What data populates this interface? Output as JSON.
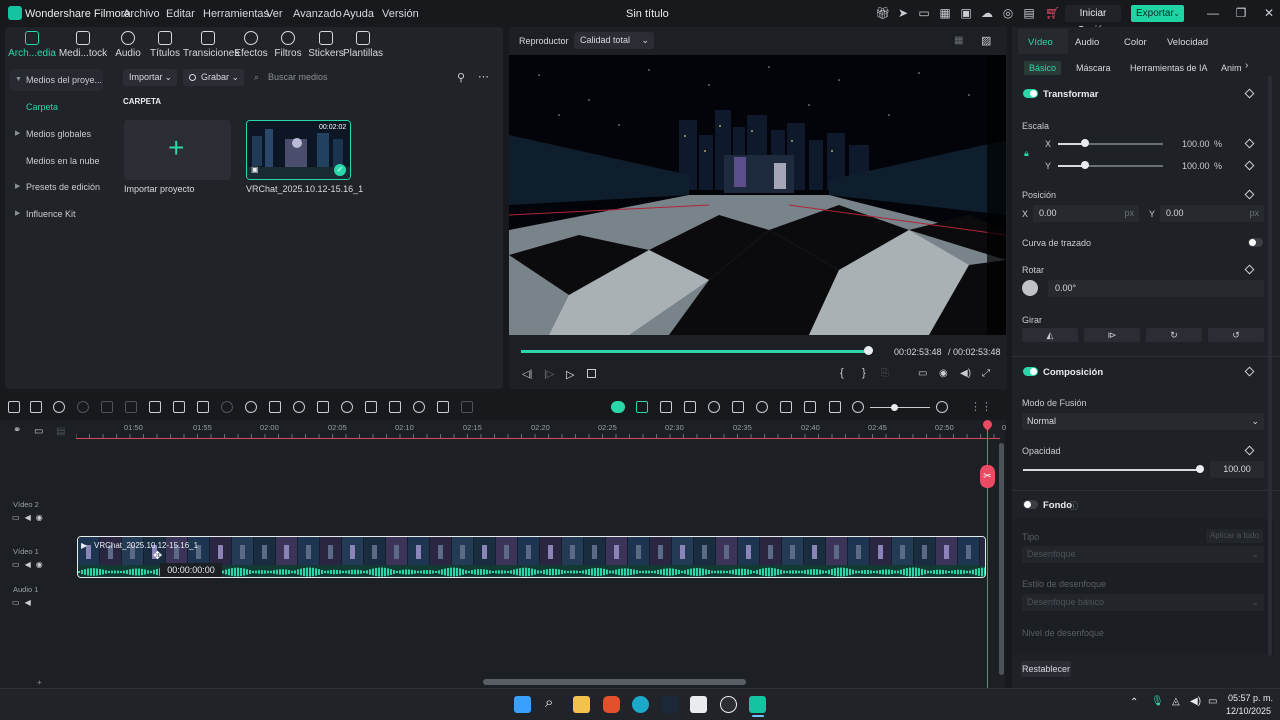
{
  "titlebar": {
    "app_name": "Wondershare Filmora",
    "menu": [
      "Archivo",
      "Editar",
      "Herramientas",
      "Ver",
      "Avanzado",
      "Ayuda",
      "Versión"
    ],
    "project_title": "Sin título",
    "login_label": "Iniciar Sesión",
    "export_label": "Exportar"
  },
  "media": {
    "tabs": [
      {
        "label": "Arch...edia",
        "icon": "folder-icon"
      },
      {
        "label": "Medi...tock",
        "icon": "stock-media-icon"
      },
      {
        "label": "Audio",
        "icon": "music-note-icon"
      },
      {
        "label": "Títulos",
        "icon": "text-icon"
      },
      {
        "label": "Transiciones",
        "icon": "transition-icon"
      },
      {
        "label": "Efectos",
        "icon": "effects-icon"
      },
      {
        "label": "Filtros",
        "icon": "filter-icon"
      },
      {
        "label": "Stickers",
        "icon": "sticker-icon"
      },
      {
        "label": "Plantillas",
        "icon": "template-icon"
      }
    ],
    "sidebar": [
      "Medios del proye...",
      "Carpeta",
      "Medios globales",
      "Medios en la nube",
      "Presets de edición",
      "Influence Kit"
    ],
    "import_label": "Importar",
    "record_label": "Grabar",
    "search_placeholder": "Buscar medios",
    "folder_label": "CARPETA",
    "import_project_label": "Importar proyecto",
    "clip_name": "VRChat_2025.10.12-15.16_1",
    "clip_duration": "00:02:02"
  },
  "player": {
    "label": "Reproductor",
    "quality": "Calidad total",
    "current_time": "00:02:53:48",
    "total_time": "/ 00:02:53:48",
    "progress": 1.0
  },
  "props": {
    "tabs": [
      "Vídeo",
      "Audio",
      "Color",
      "Velocidad"
    ],
    "subtabs": [
      "Básico",
      "Máscara",
      "Herramientas de IA",
      "Anim"
    ],
    "transform": "Transformar",
    "scale": "Escala",
    "x_label": "X",
    "y_label": "Y",
    "scale_x": "100.00",
    "scale_y": "100.00",
    "percent": "%",
    "position": "Posición",
    "pos_x": "0.00",
    "pos_y": "0.00",
    "px": "px",
    "path_curve": "Curva de trazado",
    "rotate": "Rotar",
    "rotate_value": "0.00°",
    "flip": "Girar",
    "composition": "Composición",
    "blend_mode": "Modo de Fusión",
    "blend_value": "Normal",
    "opacity": "Opacidad",
    "opacity_value": "100.00",
    "background": "Fondo",
    "type": "Tipo",
    "apply_all": "Aplicar a todo",
    "blur_value": "Desenfoque",
    "blur_style": "Estilo de desenfoque",
    "blur_style_value": "Desenfoque básico",
    "blur_level": "Nivel de desenfoque",
    "reset": "Restablecer"
  },
  "timeline": {
    "ticks": [
      "01:50",
      "01:55",
      "02:00",
      "02:05",
      "02:10",
      "02:15",
      "02:20",
      "02:25",
      "02:30",
      "02:35",
      "02:40",
      "02:45",
      "02:50",
      "0"
    ],
    "tracks": [
      "Vídeo 2",
      "Vídeo 1",
      "Audio 1"
    ],
    "clip_title": "VRChat_2025.10.12-15.16_1",
    "clip_time": "00:00:00:00"
  },
  "taskbar": {
    "time": "05:57 p. m.",
    "date": "12/10/2025"
  },
  "colors": {
    "accent": "#2bd6a8",
    "playhead": "#e94b62"
  }
}
